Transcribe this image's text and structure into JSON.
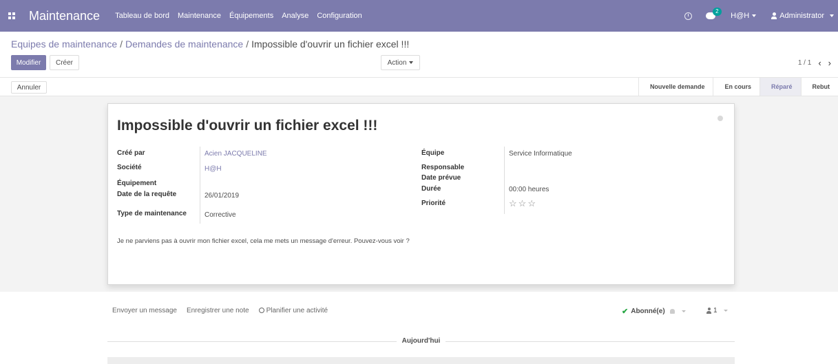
{
  "navbar": {
    "app_name": "Maintenance",
    "menu": [
      "Tableau de bord",
      "Maintenance",
      "Équipements",
      "Analyse",
      "Configuration"
    ],
    "chat_count": "2",
    "company": "H@H",
    "user": "Administrator",
    "accent_color": "#7c7bad"
  },
  "breadcrumb": {
    "items": [
      "Equipes de maintenance",
      "Demandes de maintenance"
    ],
    "current": "Impossible d'ouvrir un fichier excel !!!"
  },
  "controls": {
    "edit_label": "Modifier",
    "create_label": "Créer",
    "action_label": "Action",
    "pager": "1 / 1"
  },
  "statusbar": {
    "cancel_label": "Annuler",
    "stages": [
      "Nouvelle demande",
      "En cours",
      "Réparé",
      "Rebut"
    ],
    "active_stage": "Réparé"
  },
  "record": {
    "title": "Impossible d'ouvrir un fichier excel !!!",
    "left_fields": [
      {
        "label": "Créé par",
        "value": "Acien JACQUELINE"
      },
      {
        "label": "Société",
        "value": "H@H"
      },
      {
        "label": "Équipement",
        "value": ""
      },
      {
        "label": "Date de la requête",
        "value": "26/01/2019"
      },
      {
        "label": "Type de maintenance",
        "value": "Corrective"
      }
    ],
    "right_fields": [
      {
        "label": "Équipe",
        "value": "Service Informatique"
      },
      {
        "label": "Responsable",
        "value": ""
      },
      {
        "label": "Date prévue",
        "value": ""
      },
      {
        "label": "Durée",
        "value": "00:00  heures"
      },
      {
        "label": "Priorité",
        "value": ""
      }
    ],
    "priority_stars": 0,
    "description": "Je ne parviens pas à ouvrir mon fichier excel, cela me mets un message d'erreur. Pouvez-vous voir ?"
  },
  "chatter": {
    "send_message": "Envoyer un message",
    "log_note": "Enregistrer une note",
    "schedule_activity": "Planifier une activité",
    "followed_label": "Abonné(e)",
    "followers_count": "1",
    "today_label": "Aujourd'hui"
  }
}
